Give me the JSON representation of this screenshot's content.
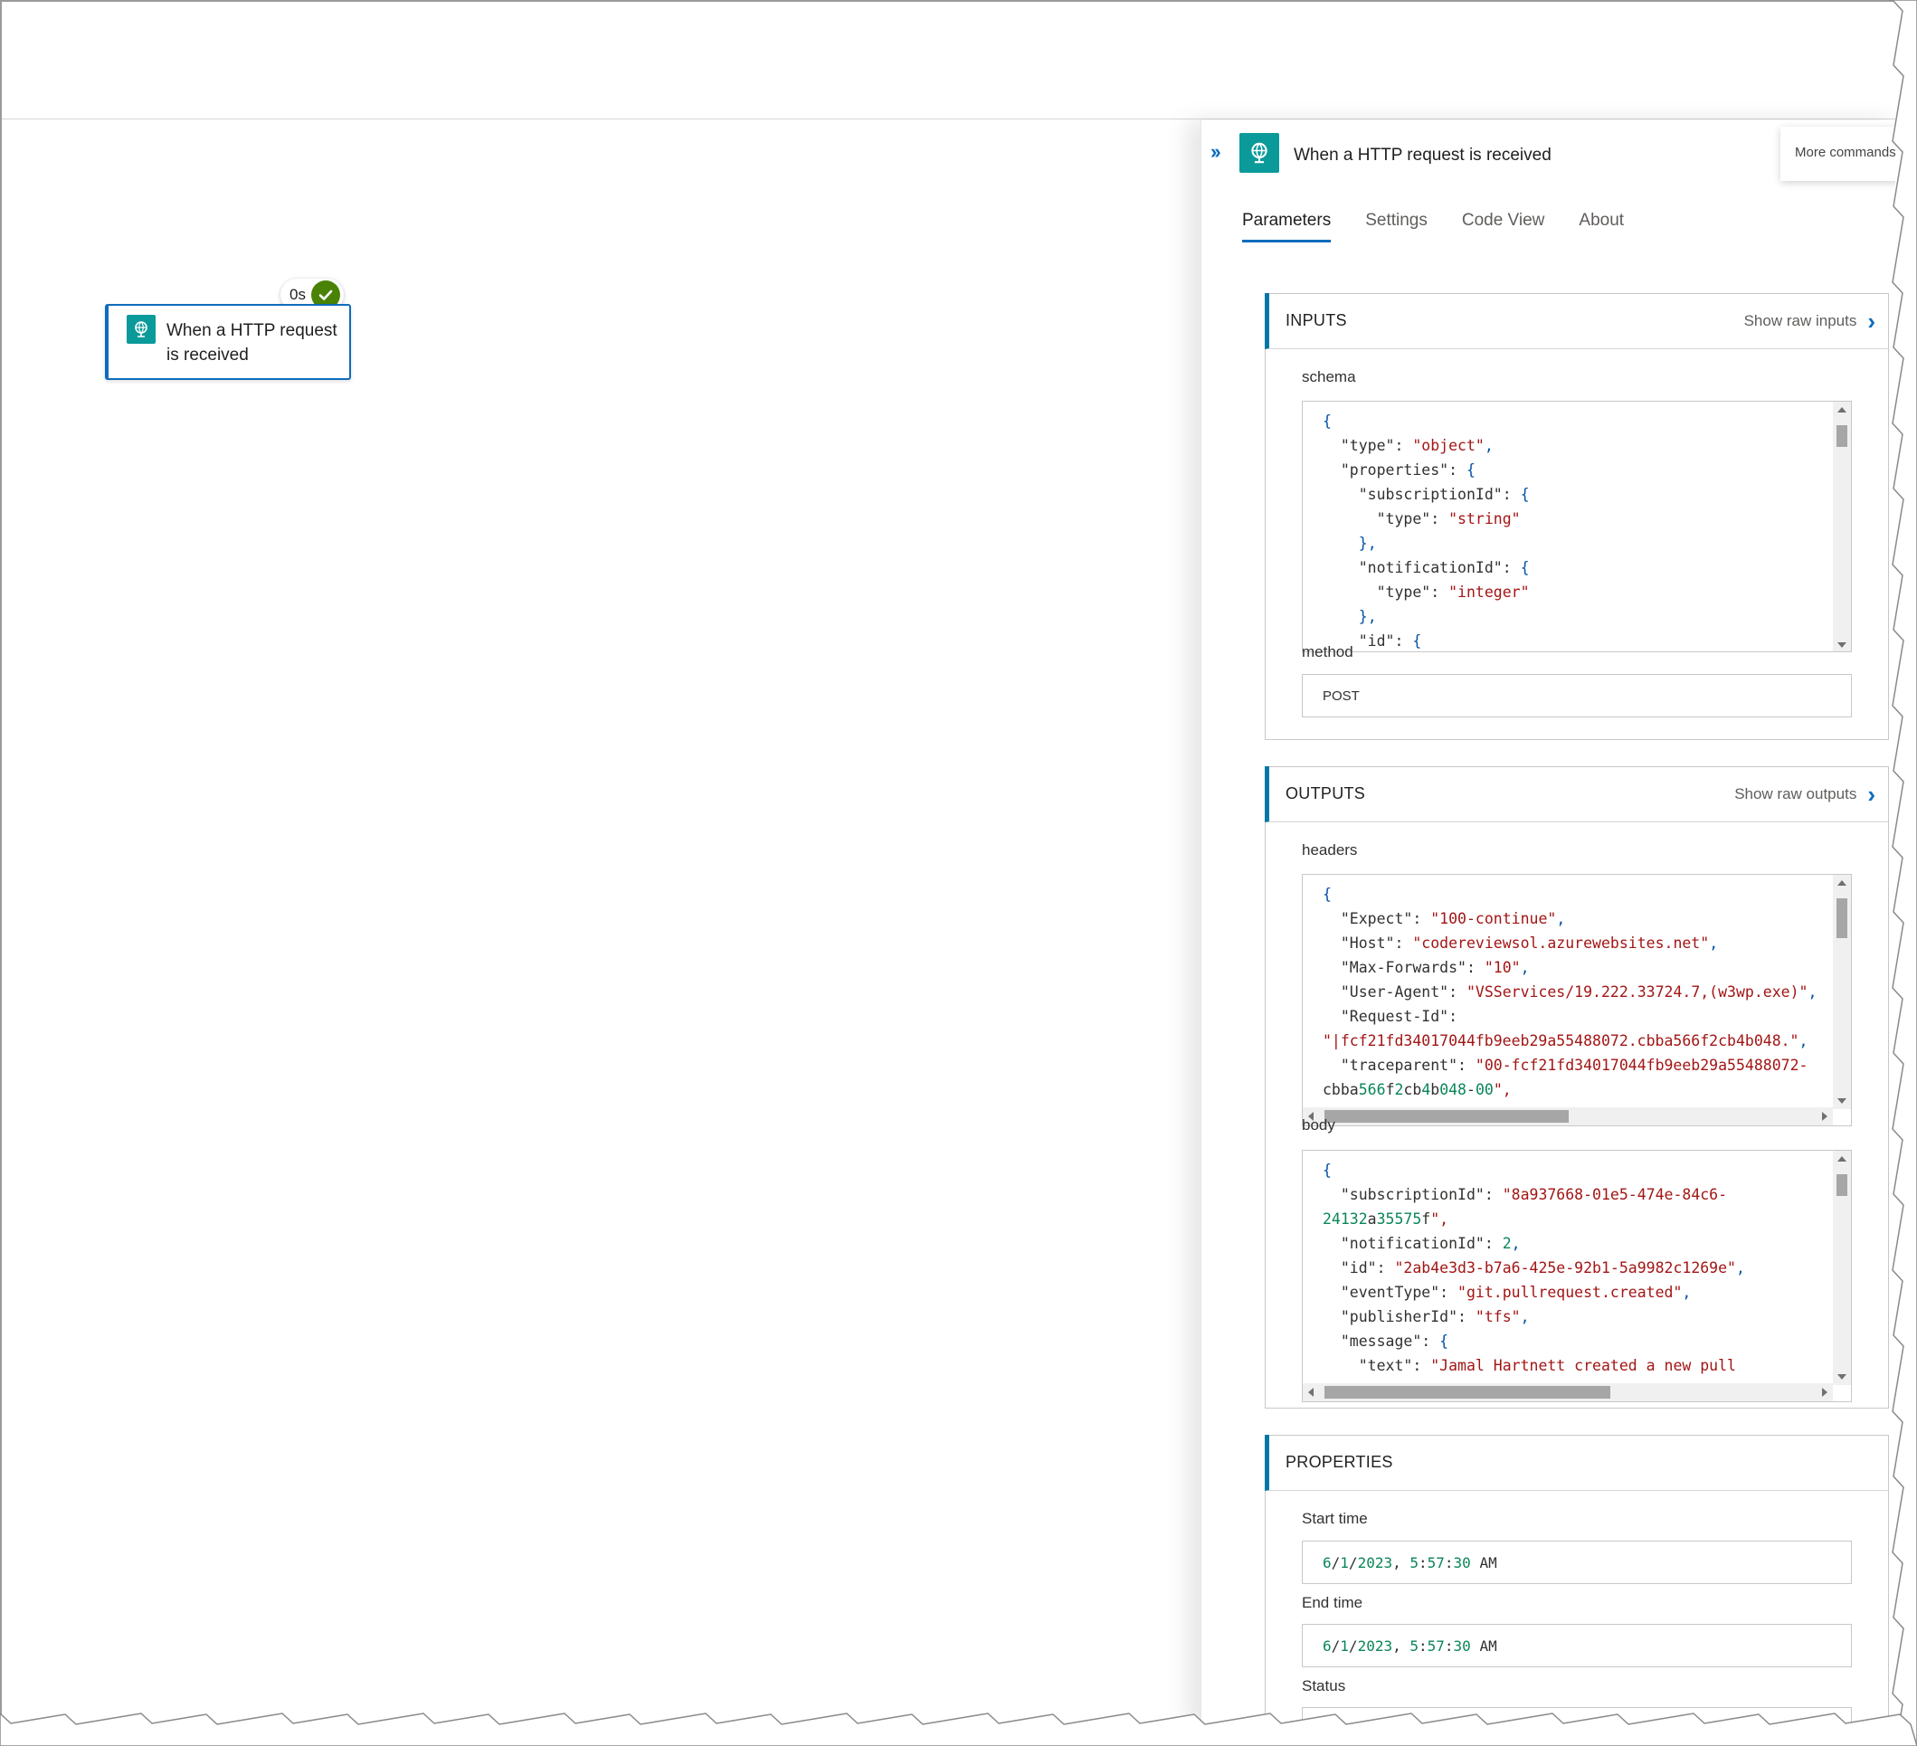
{
  "trigger": {
    "title": "When a HTTP request is received",
    "duration": "0s"
  },
  "panel": {
    "title": "When a HTTP request is received",
    "more_commands": "More commands",
    "tabs": [
      "Parameters",
      "Settings",
      "Code View",
      "About"
    ],
    "active_tab": "Parameters"
  },
  "inputs": {
    "title": "INPUTS",
    "raw_link": "Show raw inputs",
    "schema_label": "schema",
    "schema_lines": [
      "{",
      "  \"type\": \"object\",",
      "  \"properties\": {",
      "    \"subscriptionId\": {",
      "      \"type\": \"string\"",
      "    },",
      "    \"notificationId\": {",
      "      \"type\": \"integer\"",
      "    },",
      "    \"id\": {"
    ],
    "method_label": "method",
    "method_value": "POST"
  },
  "outputs": {
    "title": "OUTPUTS",
    "raw_link": "Show raw outputs",
    "headers_label": "headers",
    "headers_lines": [
      "{",
      "  \"Expect\": \"100-continue\",",
      "  \"Host\": \"codereviewsol.azurewebsites.net\",",
      "  \"Max-Forwards\": \"10\",",
      "  \"User-Agent\": \"VSServices/19.222.33724.7,(w3wp.exe)\",",
      "  \"Request-Id\":",
      "\"|fcf21fd34017044fb9eeb29a55488072.cbba566f2cb4b048.\",",
      "  \"traceparent\": \"00-fcf21fd34017044fb9eeb29a55488072-",
      "cbba566f2cb4b048-00\","
    ],
    "body_label": "body",
    "body_lines": [
      "{",
      "  \"subscriptionId\": \"8a937668-01e5-474e-84c6-",
      "24132a35575f\",",
      "  \"notificationId\": 2,",
      "  \"id\": \"2ab4e3d3-b7a6-425e-92b1-5a9982c1269e\",",
      "  \"eventType\": \"git.pullrequest.created\",",
      "  \"publisherId\": \"tfs\",",
      "  \"message\": {",
      "    \"text\": \"Jamal Hartnett created a new pull"
    ]
  },
  "properties": {
    "title": "PROPERTIES",
    "start_label": "Start time",
    "start_value": "6/1/2023, 5:57:30 AM",
    "end_label": "End time",
    "end_value": "6/1/2023, 5:57:30 AM",
    "status_label": "Status"
  },
  "colors": {
    "accent": "#0f6cbd",
    "connector_icon": "#0b9a9a",
    "success": "#498205",
    "json_string": "#a31515",
    "json_brace": "#0451a5",
    "json_number": "#098658"
  }
}
